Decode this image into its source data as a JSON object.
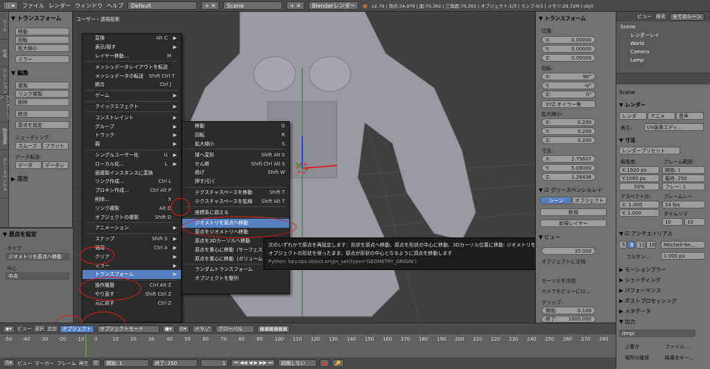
{
  "topbar": {
    "file": "ファイル",
    "render": "レンダー",
    "window": "ウィンドウ",
    "help": "ヘルプ",
    "layout": "Default",
    "scene": "Scene",
    "engine": "Blenderレンダー",
    "stats": "v2.79 | 頂点:34,979 | 面:70,392 | 三角面:70,392 | オブジェクト:1/3 | ランプ:0/1 | メモリ:29.72M | obj0"
  },
  "shelf": {
    "transform_header": "▼ トランスフォーム",
    "buttons": [
      "移動",
      "回転",
      "拡大縮小"
    ],
    "mirror": "ミラー",
    "edit_header": "▼ 編集",
    "edit_buttons": [
      "複製",
      "リンク複製",
      "削除"
    ],
    "join": "統合",
    "origin_select": "原点を設定",
    "shading_label": "シェーディング:",
    "smooth": "スムーズ",
    "flat": "フラット",
    "data_transfer": "データ転送:",
    "data": "データ",
    "data2": "データレ",
    "history": "▶ 履歴",
    "tabs": [
      "ツール",
      "作成",
      "リレーション",
      "アニメーション",
      "物理演算",
      "グリースペンシル"
    ]
  },
  "oppanel": {
    "header": "▼ 原点を設定",
    "type_label": "タイプ",
    "type_value": "ジオメトリを原点へ移動",
    "center_label": "中心",
    "center_value": "中点"
  },
  "viewport": {
    "title": "ユーザー・透視投影"
  },
  "objmenu": {
    "items": [
      [
        "変換",
        "Alt C",
        "▶"
      ],
      [
        "表示/隠す",
        "",
        "▶"
      ],
      [
        "レイヤー移動...",
        "M",
        ""
      ],
      null,
      [
        "メッシュデータレイアウトを転送",
        "",
        ""
      ],
      [
        "メッシュデータの転送",
        "Shift Ctrl T",
        ""
      ],
      [
        "統合",
        "Ctrl J",
        ""
      ],
      null,
      [
        "ゲーム",
        "",
        "▶"
      ],
      null,
      [
        "クイックエフェクト",
        "",
        "▶"
      ],
      null,
      [
        "コンストレイント",
        "",
        "▶"
      ],
      [
        "グループ",
        "",
        "▶"
      ],
      [
        "トラック",
        "",
        "▶"
      ],
      [
        "親",
        "",
        "▶"
      ],
      null,
      [
        "シングルユーザー化",
        "U",
        "▶"
      ],
      [
        "ローカル化...",
        "L",
        "▶"
      ],
      [
        "面複製インスタンスに変換",
        "",
        ""
      ],
      [
        "リンク作成...",
        "Ctrl L",
        ""
      ],
      [
        "プロキシ作成...",
        "Ctrl Alt P",
        ""
      ],
      [
        "削除...",
        "X",
        ""
      ],
      [
        "リンク複製",
        "Alt D",
        ""
      ],
      [
        "オブジェクトの複製",
        "Shift D",
        ""
      ],
      null,
      [
        "アニメーション",
        "",
        "▶"
      ],
      null,
      [
        "スナップ",
        "Shift S",
        "▶"
      ],
      [
        "適用",
        "Ctrl A",
        "▶"
      ],
      [
        "クリア",
        "",
        "▶"
      ],
      [
        "ミラー",
        "",
        "▶"
      ],
      [
        "トランスフォーム",
        "",
        "▶"
      ],
      null,
      [
        "操作履歴",
        "Ctrl Alt Z",
        ""
      ],
      [
        "やり直す",
        "Shift Ctrl Z",
        ""
      ],
      [
        "元に戻す",
        "Ctrl Z",
        ""
      ]
    ]
  },
  "submenu": {
    "items": [
      [
        "移動",
        "G"
      ],
      [
        "回転",
        "R"
      ],
      [
        "拡大縮小",
        "S"
      ],
      null,
      [
        "球へ変形",
        "Shift Alt S"
      ],
      [
        "せん断",
        "Shift Ctrl Alt S"
      ],
      [
        "曲げ",
        "Shift W"
      ],
      [
        "押す/引く",
        ""
      ],
      null,
      [
        "テクスチャスペースを移動",
        "Shift T"
      ],
      [
        "テクスチャスペースを拡縮",
        "Shift Alt T"
      ],
      null,
      [
        "座標系に揃える",
        ""
      ],
      null,
      [
        "ジオメトリを原点へ移動",
        ""
      ],
      [
        "原点をジオメトリへ移動",
        ""
      ],
      [
        "原点を3Dカーソルへ移動",
        ""
      ],
      [
        "原点を重心に移動（サーフェス",
        ""
      ],
      [
        "原点を重心に移動（ボリューム",
        ""
      ],
      null,
      [
        "ランダムトランスフォーム",
        ""
      ],
      [
        "オブジェクトを整列",
        ""
      ]
    ],
    "highlight_index": 14
  },
  "tooltip": {
    "line1": "次のいずれかで原点を再設定します：形状を原点へ移動、原点を形状の中心に移動、3Dカーソル位置に移動: ジオメトリを原点へ移動",
    "line2": "オブジェクトの形状を保ったまま、原点が形状の中心となるように頂点を移動します",
    "line3": "Python: bpy.ops.object.origin_set(type='GEOMETRY_ORIGIN')"
  },
  "npanel": {
    "header": "▼ トランスフォーム",
    "location": "位置:",
    "loc": [
      [
        "X:",
        "0.00000"
      ],
      [
        "Y:",
        "0.00000"
      ],
      [
        "Z:",
        "0.00000"
      ]
    ],
    "rotation": "回転:",
    "rot": [
      [
        "X:",
        "90°"
      ],
      [
        "Y:",
        "-0°"
      ],
      [
        "Z:",
        "0°"
      ]
    ],
    "euler": "XYZ オイラー角",
    "scale": "拡大縮小:",
    "scl": [
      [
        "X:",
        "0.200"
      ],
      [
        "Y:",
        "0.200"
      ],
      [
        "Z:",
        "0.200"
      ]
    ],
    "dims": "寸法:",
    "dim": [
      [
        "X:",
        "2.75607"
      ],
      [
        "Y:",
        "5.08000"
      ],
      [
        "Z:",
        "1.26436"
      ]
    ],
    "grease": "▼ ☑ グリースペンシルレイ",
    "scene_btn": "シーン",
    "object_btn": "オブジェクト",
    "new_btn": "新規",
    "new_layer": "新規レイヤー",
    "view_header": "▼ ビュー",
    "lens_val": "35.000",
    "lock_obj": "オブジェクトに注視:",
    "lock_cursor": "カーソルを注視",
    "cam_view": "カメラをビューにロ...",
    "clip": "クリップ:",
    "clip_start_l": "開始:",
    "clip_start": "0.100",
    "clip_end_l": "終了:",
    "clip_end": "1000.000"
  },
  "outliner": {
    "view": "ビュー",
    "search": "検索",
    "all_scenes": "全てのシーン",
    "items": [
      "Scene",
      "レンダーレイ",
      "World",
      "Camera",
      "Lamp"
    ]
  },
  "props": {
    "scene": "Scene",
    "render_h": "▼ レンダー",
    "render_btn": "レンダ",
    "anim_btn": "アニメ",
    "audio_btn": "音声",
    "display": "表示:",
    "display_val": "UV画像エディ...",
    "dims_h": "▼ 寸法",
    "preset": "レンダープリセット",
    "res": "解像度:",
    "frange": "フレーム範囲:",
    "resx": "X:1920 px",
    "resy": "Y:1080 px",
    "pct": "50%",
    "start": "開始:",
    "start_v": "1",
    "end": "最終:",
    "end_v": "250",
    "step": "フレー:",
    "step_v": "1",
    "aspect": "アスペクト比:",
    "fps_l": "フレームレー",
    "ax": "X: 1.000",
    "ay": "Y: 1.000",
    "fps": "24 fps",
    "timemap": "タイムリマ",
    "tm1": "10",
    "tm2": "10",
    "aa_h": "▼ ☑ アンチエイリアス",
    "aa": [
      "5",
      "8",
      "11",
      "16"
    ],
    "aa_filter": "Mitchell-Ne...",
    "full": "フルサン...",
    "px": "1.000 px",
    "sections": [
      "▶ モーションブラー",
      "▶ シェーディング",
      "▶ パフォーマンス",
      "▶ ポストプロセッシング",
      "▶ メタデータ",
      "▼ 出力"
    ],
    "path": "/tmp\\",
    "overwrite": "上書き",
    "file_ext": "ファイル...",
    "placeholders": "場所の確保",
    "cache": "結果をキー..."
  },
  "vhead": {
    "view": "ビュー",
    "select": "選択",
    "add": "追加",
    "object": "オブジェクト",
    "mode": "オブジェクトモード",
    "global": "グローバル"
  },
  "timeline": {
    "ticks": [
      "-50",
      "-40",
      "-30",
      "-20",
      "-10",
      "0",
      "10",
      "20",
      "30",
      "40",
      "50",
      "60",
      "70",
      "80",
      "90",
      "100",
      "110",
      "120",
      "130",
      "140",
      "150",
      "160",
      "170",
      "180",
      "190",
      "200",
      "210",
      "220",
      "230",
      "240",
      "250",
      "260",
      "270",
      "280"
    ]
  },
  "tlhead": {
    "view": "ビュー",
    "marker": "マーカー",
    "frame": "フレーム",
    "play": "再生",
    "start_l": "開始:",
    "start": "1",
    "end_l": "終了:",
    "end": "250",
    "cur": "1",
    "sync": "同期しない"
  }
}
